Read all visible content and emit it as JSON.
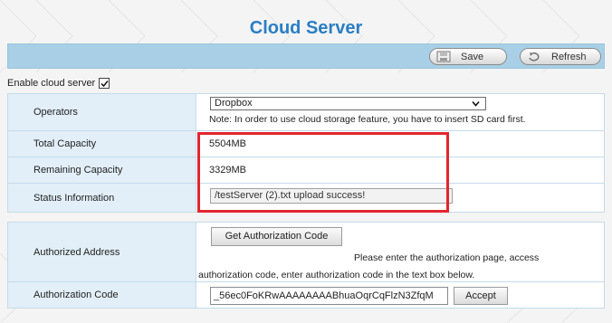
{
  "page": {
    "title": "Cloud Server"
  },
  "toolbar": {
    "save_label": "Save",
    "refresh_label": "Refresh"
  },
  "enable": {
    "label": "Enable cloud server",
    "checked": true
  },
  "settings": {
    "operators_label": "Operators",
    "operator_value": "Dropbox",
    "operator_note": "Note: In order to use cloud storage feature, you have to insert SD card first.",
    "total_label": "Total Capacity",
    "total_value": "5504MB",
    "remaining_label": "Remaining Capacity",
    "remaining_value": "3329MB",
    "status_label": "Status Information",
    "status_value": "/testServer (2).txt upload success!"
  },
  "auth": {
    "address_label": "Authorized Address",
    "get_code_label": "Get Authorization Code",
    "note_line1": "Please enter the authorization page, access",
    "note_line2": "authorization code, enter authorization code in the text box below.",
    "code_label": "Authorization Code",
    "code_value": "_56ec0FoKRwAAAAAAAABhuaOqrCqFlzN3ZfqM",
    "accept_label": "Accept"
  },
  "colors": {
    "title": "#2a7ec4",
    "toolbar": "#a8cfe6",
    "label_cell": "#e2eff8",
    "highlight": "#e3262d"
  }
}
